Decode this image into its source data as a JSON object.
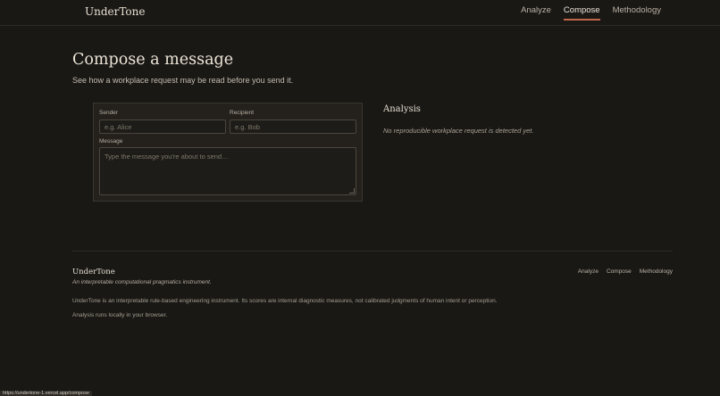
{
  "nav": {
    "brand": "UnderTone",
    "links": [
      "Analyze",
      "Compose",
      "Methodology"
    ],
    "active": "Compose"
  },
  "page": {
    "title": "Compose a message",
    "subtitle": "See how a workplace request may be read before you send it."
  },
  "form": {
    "sender_label": "Sender",
    "sender_placeholder": "e.g. Alice",
    "recipient_label": "Recipient",
    "recipient_placeholder": "e.g. Bob",
    "message_label": "Message",
    "message_placeholder": "Type the message you're about to send…"
  },
  "analysis": {
    "title": "Analysis",
    "empty_text": "No reproducible workplace request is detected yet."
  },
  "footer": {
    "brand": "UnderTone",
    "tagline": "An interpretable computational pragmatics instrument.",
    "links": [
      "Analyze",
      "Compose",
      "Methodology"
    ],
    "description": "UnderTone is an interpretable rule-based engineering instrument. Its scores are internal diagnostic measures, not calibrated judgments of human intent or perception.",
    "local_note": "Analysis runs locally in your browser."
  },
  "status_url": "https://undertone-1.vercel.app/compose",
  "colors": {
    "background": "#1a1815",
    "accent": "#c0664a"
  }
}
